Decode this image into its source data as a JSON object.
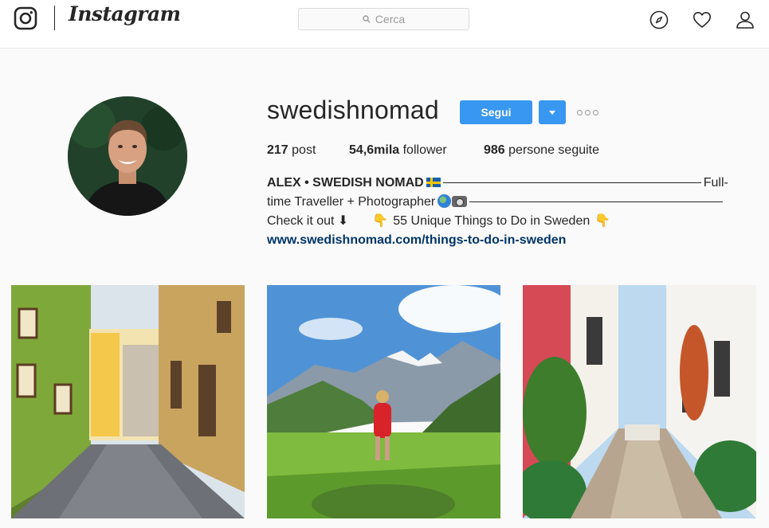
{
  "nav": {
    "brand": "Instagram",
    "search_placeholder": "Cerca",
    "icons": [
      "instagram-glyph-icon",
      "search-icon",
      "compass-icon",
      "heart-icon",
      "profile-icon"
    ]
  },
  "profile": {
    "username": "swedishnomad",
    "follow_label": "Segui",
    "stats": {
      "posts_count": "217",
      "posts_label": "post",
      "followers_count": "54,6mila",
      "followers_label": "follower",
      "following_count": "986",
      "following_label": "persone seguite"
    },
    "bio": {
      "name": "ALEX • SWEDISH NOMAD",
      "line1_tail": "Full-",
      "line2_text": "time Traveller + Photographer",
      "line3_text": "Check it out ⬇",
      "line3_link_text": "55 Unique Things to Do in Sweden",
      "website": "www.swedishnomad.com/things-to-do-in-sweden"
    }
  },
  "posts": [
    {
      "subject": "colorful cobblestone street"
    },
    {
      "subject": "woman in red in alpine valley"
    },
    {
      "subject": "whitewashed alley with plants"
    }
  ],
  "colors": {
    "accent": "#3897f0",
    "link": "#003569",
    "text": "#262626",
    "background": "#fafafa"
  }
}
